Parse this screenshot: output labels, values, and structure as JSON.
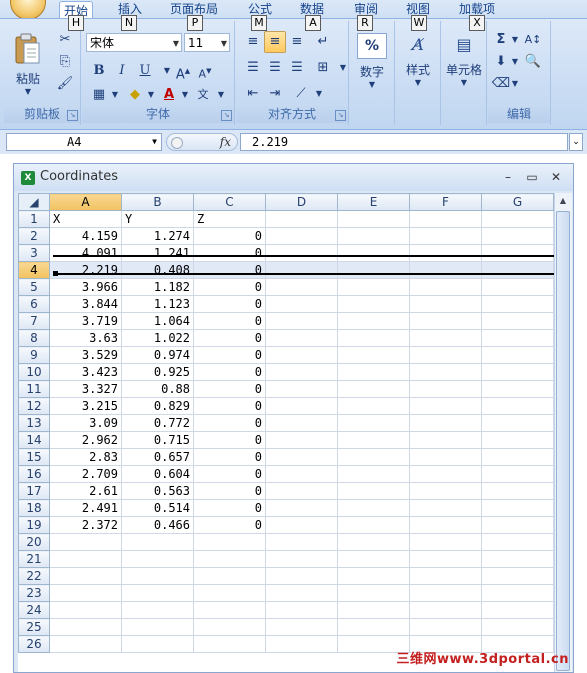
{
  "ribbon": {
    "tabs": [
      {
        "label": "开始",
        "key": "H"
      },
      {
        "label": "插入",
        "key": "N"
      },
      {
        "label": "页面布局",
        "key": "P"
      },
      {
        "label": "公式",
        "key": "M"
      },
      {
        "label": "数据",
        "key": "A"
      },
      {
        "label": "审阅",
        "key": "R"
      },
      {
        "label": "视图",
        "key": "W"
      },
      {
        "label": "加载项",
        "key": "X"
      }
    ],
    "clipboard": {
      "paste_label": "粘贴",
      "group_label": "剪贴板"
    },
    "font": {
      "font_name": "宋体",
      "font_size": "11",
      "group_label": "字体",
      "bold": "B",
      "italic": "I",
      "underline": "U"
    },
    "alignment": {
      "group_label": "对齐方式"
    },
    "number": {
      "label": "数字",
      "symbol": "%"
    },
    "styles": {
      "label": "样式"
    },
    "cells": {
      "label": "单元格"
    },
    "editing": {
      "group_label": "编辑",
      "sum": "Σ"
    }
  },
  "formula_bar": {
    "name_box": "A4",
    "fx": "fx",
    "value": "2.219"
  },
  "workbook": {
    "title": "Coordinates",
    "columns": [
      "A",
      "B",
      "C",
      "D",
      "E",
      "F",
      "G"
    ],
    "selected_row": 4,
    "rows": [
      {
        "n": "1",
        "a": "X",
        "b": "Y",
        "c": "Z"
      },
      {
        "n": "2",
        "a": "4.159",
        "b": "1.274",
        "c": "0"
      },
      {
        "n": "3",
        "a": "4.091",
        "b": "1.241",
        "c": "0"
      },
      {
        "n": "4",
        "a": "2.219",
        "b": "0.408",
        "c": "0"
      },
      {
        "n": "5",
        "a": "3.966",
        "b": "1.182",
        "c": "0"
      },
      {
        "n": "6",
        "a": "3.844",
        "b": "1.123",
        "c": "0"
      },
      {
        "n": "7",
        "a": "3.719",
        "b": "1.064",
        "c": "0"
      },
      {
        "n": "8",
        "a": "3.63",
        "b": "1.022",
        "c": "0"
      },
      {
        "n": "9",
        "a": "3.529",
        "b": "0.974",
        "c": "0"
      },
      {
        "n": "10",
        "a": "3.423",
        "b": "0.925",
        "c": "0"
      },
      {
        "n": "11",
        "a": "3.327",
        "b": "0.88",
        "c": "0"
      },
      {
        "n": "12",
        "a": "3.215",
        "b": "0.829",
        "c": "0"
      },
      {
        "n": "13",
        "a": "3.09",
        "b": "0.772",
        "c": "0"
      },
      {
        "n": "14",
        "a": "2.962",
        "b": "0.715",
        "c": "0"
      },
      {
        "n": "15",
        "a": "2.83",
        "b": "0.657",
        "c": "0"
      },
      {
        "n": "16",
        "a": "2.709",
        "b": "0.604",
        "c": "0"
      },
      {
        "n": "17",
        "a": "2.61",
        "b": "0.563",
        "c": "0"
      },
      {
        "n": "18",
        "a": "2.491",
        "b": "0.514",
        "c": "0"
      },
      {
        "n": "19",
        "a": "2.372",
        "b": "0.466",
        "c": "0"
      },
      {
        "n": "20",
        "a": "",
        "b": "",
        "c": ""
      },
      {
        "n": "21",
        "a": "",
        "b": "",
        "c": ""
      },
      {
        "n": "22",
        "a": "",
        "b": "",
        "c": ""
      },
      {
        "n": "23",
        "a": "",
        "b": "",
        "c": ""
      },
      {
        "n": "24",
        "a": "",
        "b": "",
        "c": ""
      },
      {
        "n": "25",
        "a": "",
        "b": "",
        "c": ""
      },
      {
        "n": "26",
        "a": "",
        "b": "",
        "c": ""
      }
    ]
  },
  "watermark": "三维网www.3dportal.cn",
  "colors": {
    "ribbon_bg": "#c8dbf3",
    "selected_header": "#f1c15f",
    "accent": "#15428b"
  }
}
